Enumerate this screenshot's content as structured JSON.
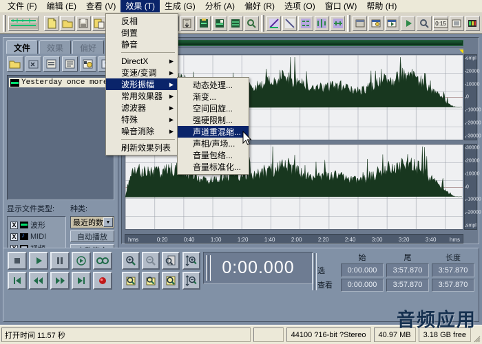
{
  "menubar": {
    "items": [
      {
        "label": "文件 (F)",
        "active": false
      },
      {
        "label": "编辑 (E)",
        "active": false
      },
      {
        "label": "查看 (V)",
        "active": false
      },
      {
        "label": "效果 (T)",
        "active": true
      },
      {
        "label": "生成 (G)",
        "active": false
      },
      {
        "label": "分析 (A)",
        "active": false
      },
      {
        "label": "偏好 (R)",
        "active": false
      },
      {
        "label": "选项 (O)",
        "active": false
      },
      {
        "label": "窗口 (W)",
        "active": false
      },
      {
        "label": "帮助 (H)",
        "active": false
      }
    ]
  },
  "effects_menu": {
    "items": [
      {
        "label": "反相",
        "submenu": false,
        "highlight": false
      },
      {
        "label": "倒置",
        "submenu": false,
        "highlight": false
      },
      {
        "label": "静音",
        "submenu": false,
        "highlight": false
      },
      {
        "separator": true
      },
      {
        "label": "DirectX",
        "submenu": true,
        "highlight": false
      },
      {
        "label": "变速/变调",
        "submenu": true,
        "highlight": false
      },
      {
        "label": "波形振幅",
        "submenu": true,
        "highlight": true
      },
      {
        "label": "常用效果器",
        "submenu": true,
        "highlight": false
      },
      {
        "label": "滤波器",
        "submenu": true,
        "highlight": false
      },
      {
        "label": "特殊",
        "submenu": true,
        "highlight": false
      },
      {
        "label": "噪音消除",
        "submenu": true,
        "highlight": false
      },
      {
        "separator": true
      },
      {
        "label": "刷新效果列表",
        "submenu": false,
        "highlight": false
      }
    ]
  },
  "amplitude_submenu": {
    "items": [
      {
        "label": "动态处理...",
        "highlight": false
      },
      {
        "label": "渐变...",
        "highlight": false
      },
      {
        "label": "空间回旋...",
        "highlight": false
      },
      {
        "label": "强硬限制...",
        "highlight": false
      },
      {
        "label": "声道重混缩...",
        "highlight": true
      },
      {
        "label": "声相/声场...",
        "highlight": false
      },
      {
        "label": "音量包络...",
        "highlight": false
      },
      {
        "label": "音量标准化...",
        "highlight": false
      }
    ]
  },
  "left_panel": {
    "tabs": [
      {
        "label": "文件",
        "selected": true
      },
      {
        "label": "效果",
        "selected": false
      },
      {
        "label": "偏好",
        "selected": false
      }
    ],
    "file_buttons": [
      "open-folder-icon",
      "delete-file-icon",
      "properties-icon",
      "info-icon",
      "convert-icon",
      "help-icon"
    ],
    "files": [
      {
        "name": "Yesterday once more(",
        "icon": "waveform-icon"
      }
    ],
    "filetype_label": "显示文件类型:",
    "kind_label": "种类:",
    "filetypes": [
      {
        "label": "波形",
        "checked": true,
        "icon": "waveform-icon"
      },
      {
        "label": "MIDI",
        "checked": true,
        "icon": "midi-note-icon"
      },
      {
        "label": "视频",
        "checked": true,
        "icon": "video-icon"
      }
    ],
    "kind_selected": "最近的数据",
    "buttons": [
      "自动播放",
      "完整符合"
    ]
  },
  "waveform": {
    "time_ruler": [
      "hms",
      "0:20",
      "0:40",
      "1:00",
      "1:20",
      "1:40",
      "2:00",
      "2:20",
      "2:40",
      "3:00",
      "3:20",
      "3:40",
      "hms"
    ],
    "scale_top": [
      "smpl",
      "20000",
      "10000",
      "0",
      "-10000",
      "-20000",
      "-30000"
    ],
    "scale_bottom": [
      "30000",
      "20000",
      "10000",
      "0",
      "-10000",
      "-20000",
      "smpl"
    ],
    "wave_color": "#18371f",
    "bg_color": "#eff0f2"
  },
  "transport": {
    "row1": [
      "stop-icon",
      "play-icon",
      "pause-icon",
      "play-from-cursor-icon",
      "loop-icon"
    ],
    "row2": [
      "go-to-start-icon",
      "rewind-icon",
      "fast-forward-icon",
      "go-to-end-icon",
      "record-icon"
    ],
    "zoom_row1": [
      "zoom-in-icon",
      "zoom-out-icon",
      "zoom-full-icon"
    ],
    "zoom_row2": [
      "zoom-selection-icon",
      "zoom-1to1-icon",
      "zoom-fit-icon"
    ],
    "zoom_vert": [
      "zoom-vertical-in-icon",
      "zoom-vertical-out-icon"
    ],
    "time_display": "0:00.000"
  },
  "selection_info": {
    "headers": [
      "始",
      "尾",
      "长度"
    ],
    "rows": [
      {
        "label": "选",
        "values": [
          "0:00.000",
          "3:57.870",
          "3:57.870"
        ]
      },
      {
        "label": "查看",
        "values": [
          "0:00.000",
          "3:57.870",
          "3:57.870"
        ]
      }
    ]
  },
  "statusbar": {
    "open_time": "打开时间  11.57 秒",
    "format": "44100 ?16-bit ?Stereo",
    "size": "40.97 MB",
    "free": "3.18 GB free"
  },
  "watermark": "音频应用",
  "colors": {
    "menu_highlight": "#0a246a",
    "panel_bg": "#7b8aa0",
    "toolbar_bg": "#d8d4c8",
    "wave_green": "#18371f"
  }
}
